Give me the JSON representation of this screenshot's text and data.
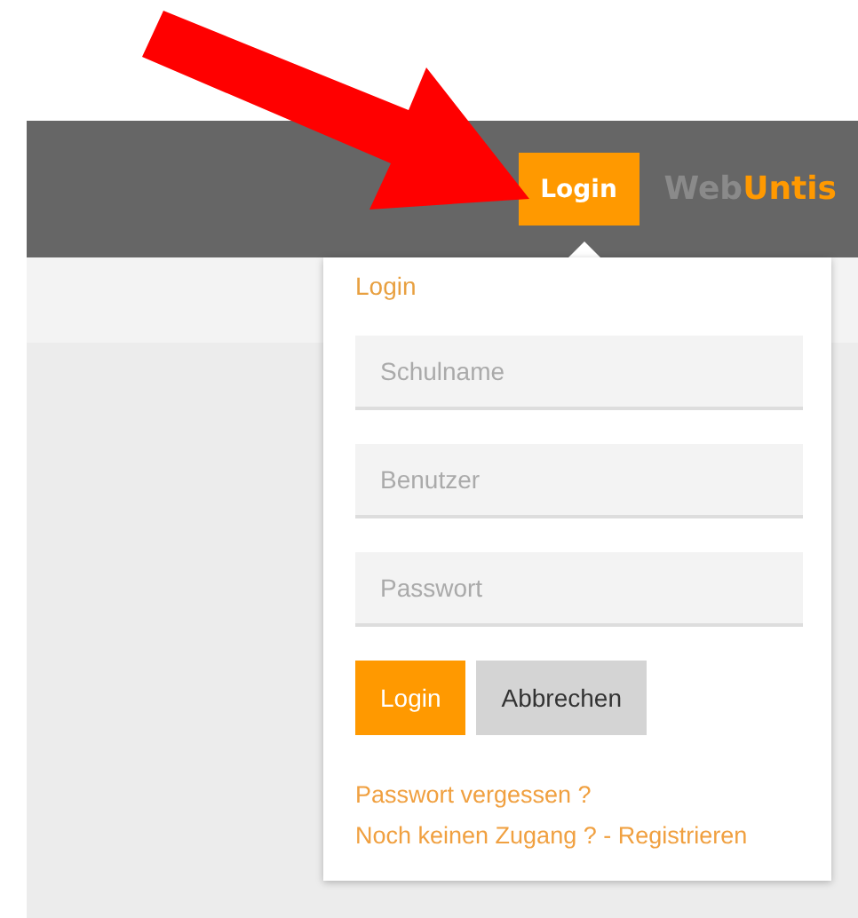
{
  "header": {
    "login_button": "Login",
    "brand": {
      "first": "Web",
      "second": "Untis"
    }
  },
  "login_popup": {
    "title": "Login",
    "fields": [
      {
        "placeholder": "Schulname"
      },
      {
        "placeholder": "Benutzer"
      },
      {
        "placeholder": "Passwort"
      }
    ],
    "buttons": [
      {
        "label": "Login",
        "kind": "primary"
      },
      {
        "label": "Abbrechen",
        "kind": "secondary"
      }
    ],
    "links": [
      "Passwort vergessen ?",
      "Noch keinen Zugang ? - Registrieren"
    ]
  }
}
